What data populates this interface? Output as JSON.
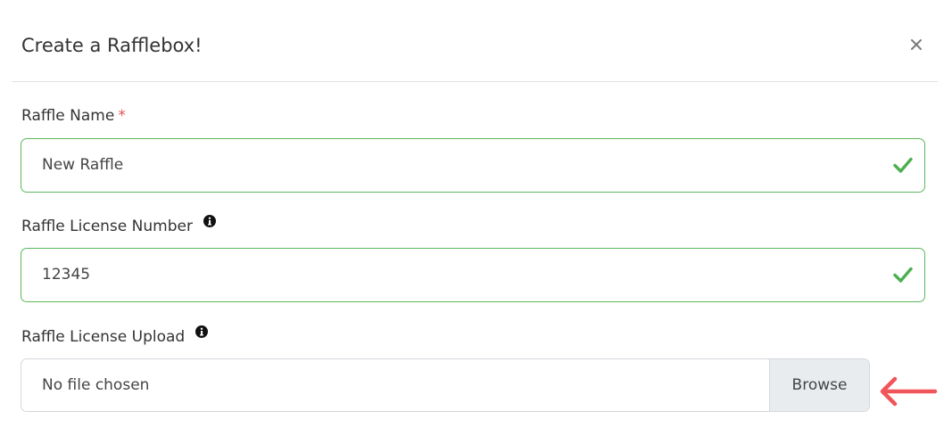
{
  "modal": {
    "title": "Create a Rafflebox!",
    "close_symbol": "×"
  },
  "fields": {
    "raffle_name": {
      "label": "Raffle Name",
      "required_marker": "*",
      "value": "New Raffle",
      "status_icon": "check-icon"
    },
    "license_number": {
      "label": "Raffle License Number",
      "info_icon": "info-icon",
      "value": "12345",
      "status_icon": "check-icon"
    },
    "license_upload": {
      "label": "Raffle License Upload",
      "info_icon": "info-icon",
      "placeholder": "No file chosen",
      "button_label": "Browse"
    }
  },
  "annotation": {
    "icon": "arrow-left-icon",
    "color": "#f0555a"
  },
  "colors": {
    "valid_border": "#5cb85c",
    "check": "#4caf50",
    "required": "#e05555"
  }
}
